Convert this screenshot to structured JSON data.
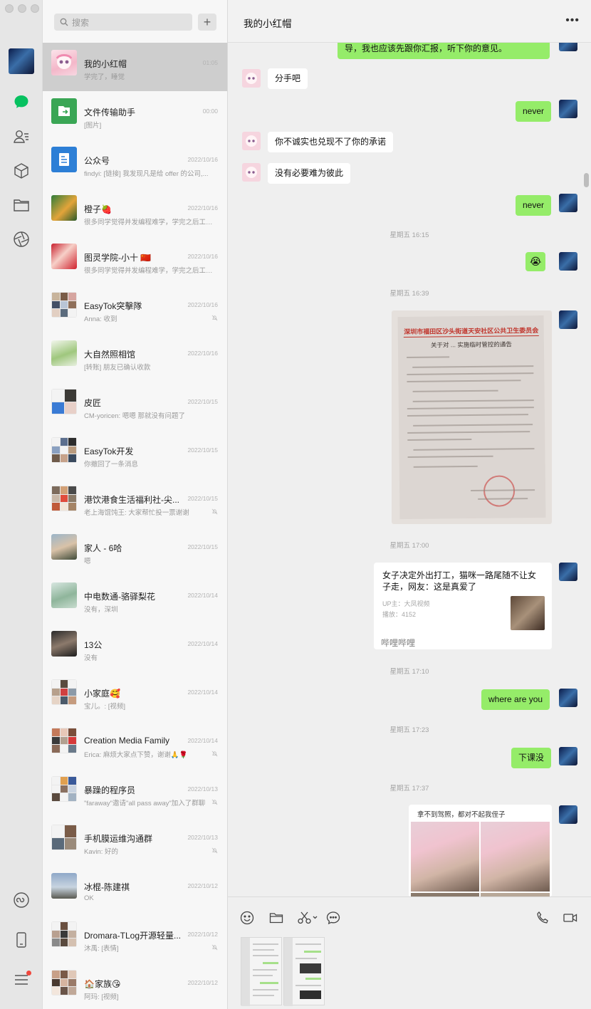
{
  "search": {
    "placeholder": "搜索"
  },
  "list_add_label": "+",
  "conversations": [
    {
      "name": "我的小红帽",
      "preview": "学完了，睡觉",
      "time": "01:05"
    },
    {
      "name": "文件传输助手",
      "preview": "[图片]",
      "time": "00:00"
    },
    {
      "name": "公众号",
      "preview": "findyi: [链接] 我发现凡是给 offer 的公司,...",
      "time": "2022/10/16"
    },
    {
      "name": "橙子🍓",
      "preview": "很多同学觉得并发编程难学，学完之后工作...",
      "time": "2022/10/16"
    },
    {
      "name": "图灵学院-小十 🇨🇳",
      "preview": "很多同学觉得并发编程难学，学完之后工作...",
      "time": "2022/10/16"
    },
    {
      "name": "EasyTok突擊隊",
      "preview": "Anna: 收到",
      "time": "2022/10/16"
    },
    {
      "name": "大自然照相馆",
      "preview": "[转账] 朋友已确认收款",
      "time": "2022/10/16"
    },
    {
      "name": "皮匠",
      "preview": "CM-yoricen: 嗯嗯 那就没有问题了",
      "time": "2022/10/15"
    },
    {
      "name": "EasyTok开发",
      "preview": "你撤回了一条消息",
      "time": "2022/10/15"
    },
    {
      "name": "港饮港食生活福利社-尖...",
      "preview": "老上海馄饨王: 大家帮忙投一票谢谢",
      "time": "2022/10/15"
    },
    {
      "name": "家人 - 6哈",
      "preview": "嗯",
      "time": "2022/10/15"
    },
    {
      "name": "中电数通-骆驿梨花",
      "preview": "没有，深圳",
      "time": "2022/10/14"
    },
    {
      "name": "13公",
      "preview": "没有",
      "time": "2022/10/14"
    },
    {
      "name": "小家庭🥰",
      "preview": "宝儿。: [视频]",
      "time": "2022/10/14"
    },
    {
      "name": "Creation Media Family",
      "preview": "Erica: 麻烦大家点下赞，谢谢🙏🌹",
      "time": "2022/10/14"
    },
    {
      "name": "暴躁的程序员",
      "preview": "\"faraway\"邀请\"all pass away\"加入了群聊",
      "time": "2022/10/13"
    },
    {
      "name": "手机膜运维沟通群",
      "preview": "Kavin: 好的",
      "time": "2022/10/13"
    },
    {
      "name": "冰棍-陈建祺",
      "preview": "OK",
      "time": "2022/10/12"
    },
    {
      "name": "Dromara-TLog开源轻量...",
      "preview": "沐禹: [表情]",
      "time": "2022/10/12"
    },
    {
      "name": "🏠家族😘",
      "preview": "阿玛: [视频]",
      "time": "2022/10/12"
    }
  ],
  "chat": {
    "title": "我的小红帽",
    "more_label": "•••",
    "messages": {
      "m0": "导，我也应该先跟你汇报，听下你的意见。",
      "m1": "分手吧",
      "m2": "never",
      "m3": "你不诚实也兑现不了你的承诺",
      "m4": "没有必要难为彼此",
      "m5": "never",
      "t1": "星期五 16:15",
      "emoji": "😭",
      "t2": "星期五 16:39",
      "t3": "星期五 17:00",
      "card": {
        "title": "女子决定外出打工，猫咪一路尾随不让女子走，网友：这是真爱了",
        "uploader": "UP主：大凤视频",
        "plays": "播放：4152",
        "source": "哔哩哔哩"
      },
      "t4": "星期五 17:10",
      "m6": "where are you",
      "t5": "星期五 17:23",
      "m7": "下课没",
      "t6": "星期五 17:37",
      "news_title": "拿不到驾照，都对不起我侄子"
    },
    "photo_doc": {
      "heading": "深圳市福田区沙头街道天安社区公共卫生委员会",
      "subheading": "关于对 ... 实施临时管控的通告"
    }
  },
  "colors": {
    "out_bubble": "#95ec69",
    "in_bubble": "#ffffff",
    "accent": "#07c160"
  }
}
